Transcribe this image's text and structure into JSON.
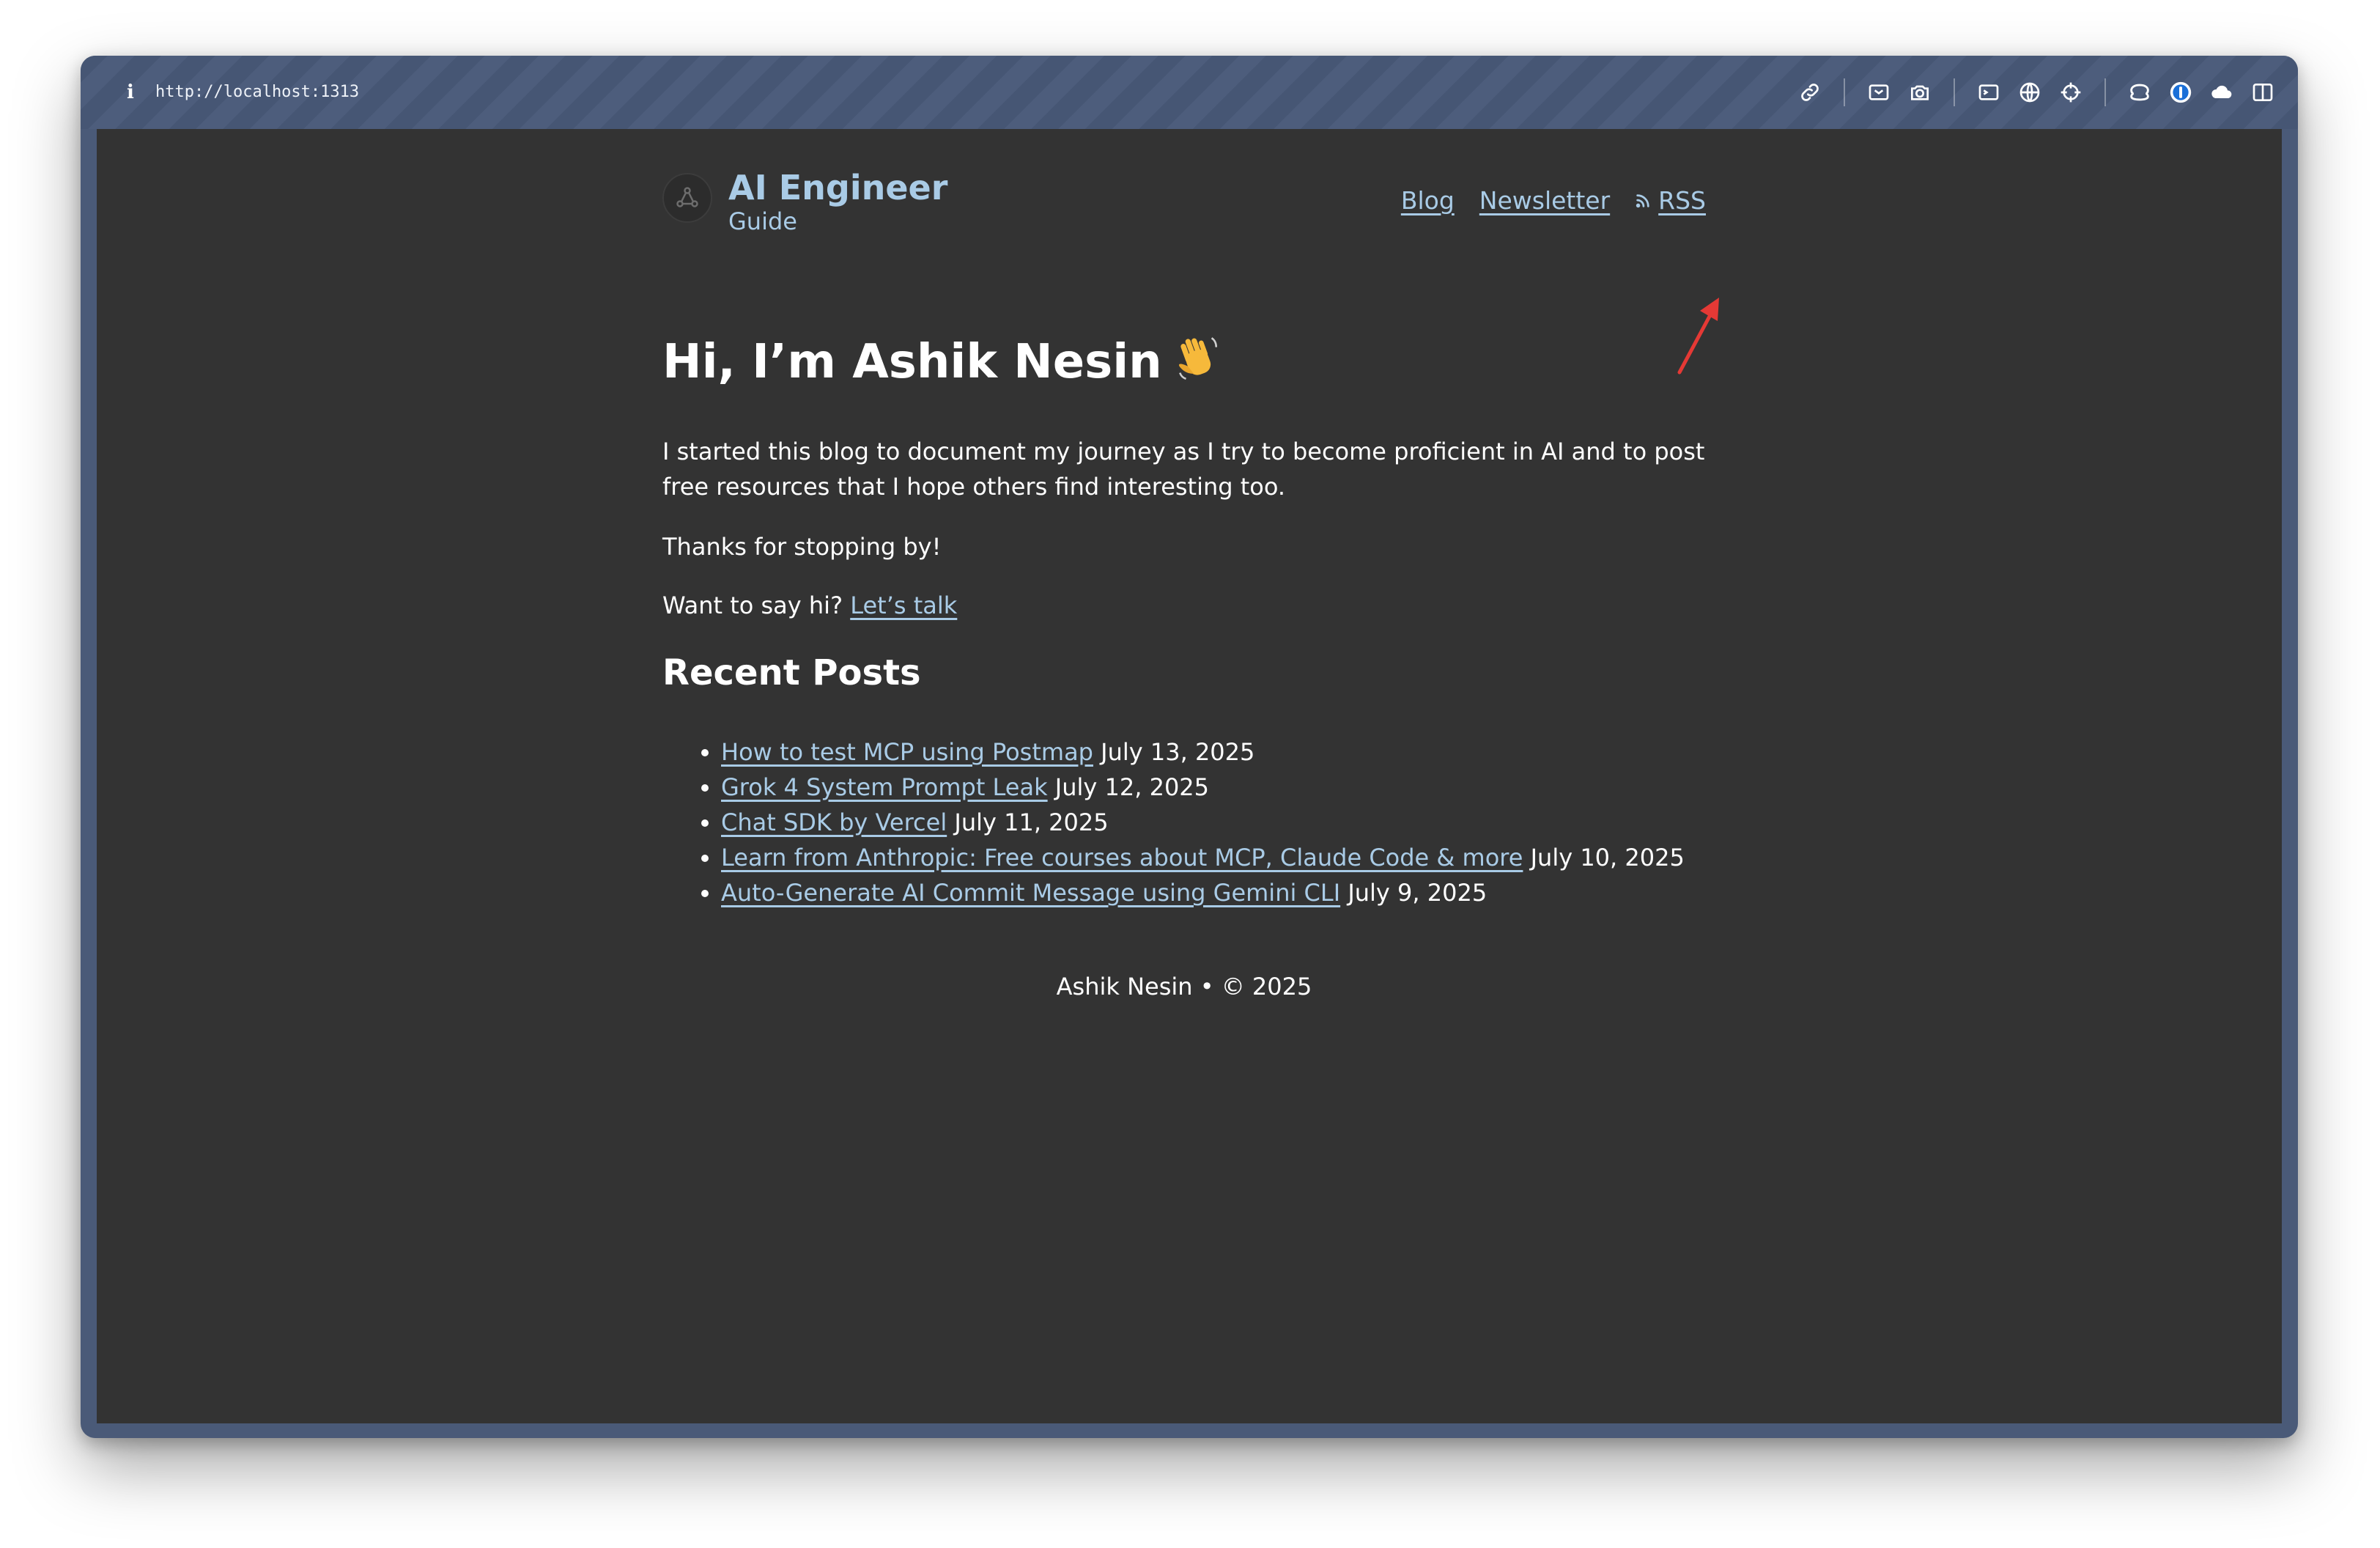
{
  "browser": {
    "info_icon": "info-icon",
    "url": "http://localhost:1313",
    "toolbar_icons": [
      "link-icon",
      "screenshot-icon",
      "camera-icon",
      "terminal-icon",
      "globe-icon",
      "crosshair-icon",
      "extensions-icon",
      "password-manager-icon",
      "cloud-icon",
      "sidebar-icon"
    ]
  },
  "site": {
    "brand_title": "AI Engineer",
    "brand_subtitle": "Guide",
    "nav": {
      "blog": "Blog",
      "newsletter": "Newsletter",
      "rss": "RSS"
    }
  },
  "intro": {
    "heading": "Hi, I’m Ashik Nesin",
    "wave_icon": "waving-hand-icon",
    "paragraph1": "I started this blog to document my journey as I try to become proficient in AI and to post free resources that I hope others find interesting too.",
    "paragraph2": "Thanks for stopping by!",
    "paragraph3_prefix": "Want to say hi? ",
    "talk_link": "Let’s talk"
  },
  "recent": {
    "heading": "Recent Posts",
    "posts": [
      {
        "title": "How to test MCP using Postmap",
        "date": "July 13, 2025"
      },
      {
        "title": "Grok 4 System Prompt Leak",
        "date": "July 12, 2025"
      },
      {
        "title": "Chat SDK by Vercel",
        "date": "July 11, 2025"
      },
      {
        "title": "Learn from Anthropic: Free courses about MCP, Claude Code & more",
        "date": "July 10, 2025"
      },
      {
        "title": "Auto-Generate AI Commit Message using Gemini CLI",
        "date": "July 9, 2025"
      }
    ]
  },
  "footer": {
    "text": "Ashik Nesin • © 2025"
  },
  "colors": {
    "background": "#333333",
    "link": "#a9cbe6",
    "annotation_arrow": "#e53935"
  }
}
